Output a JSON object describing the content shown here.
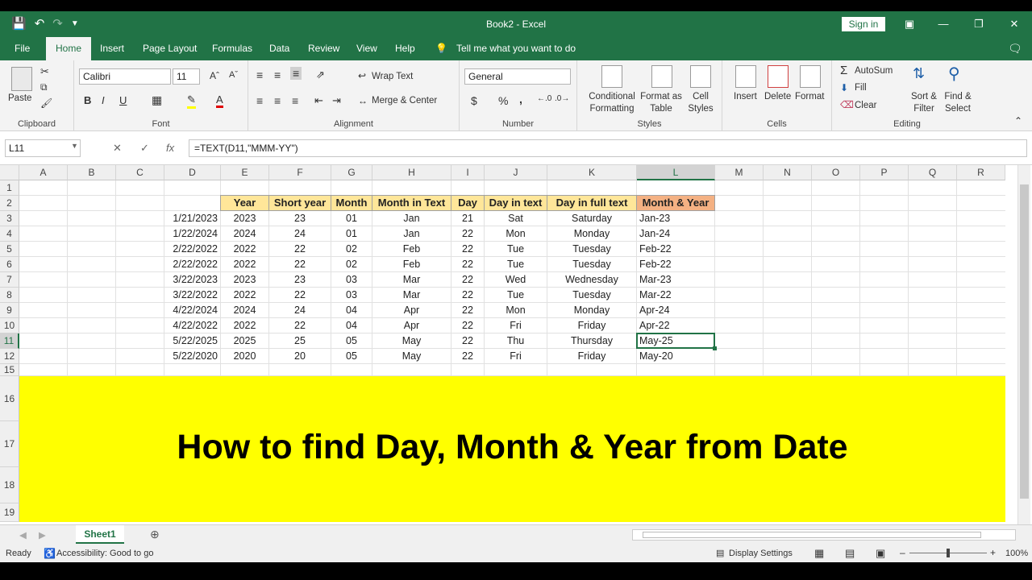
{
  "window": {
    "title": "Book2  -  Excel",
    "sign_in": "Sign in"
  },
  "tabs": [
    "File",
    "Home",
    "Insert",
    "Page Layout",
    "Formulas",
    "Data",
    "Review",
    "View",
    "Help"
  ],
  "tell_me": "Tell me what you want to do",
  "ribbon": {
    "clipboard": {
      "paste": "Paste",
      "label": "Clipboard"
    },
    "font": {
      "name": "Calibri",
      "size": "11",
      "bold": "B",
      "italic": "I",
      "underline": "U",
      "label": "Font"
    },
    "alignment": {
      "wrap": "Wrap Text",
      "merge": "Merge & Center",
      "label": "Alignment"
    },
    "number": {
      "format": "General",
      "currency": "$",
      "percent": "%",
      "comma": ",",
      "label": "Number"
    },
    "styles": {
      "conditional": "Conditional Formatting",
      "format_table": "Format as Table",
      "cell_styles": "Cell Styles",
      "label": "Styles"
    },
    "cells": {
      "insert": "Insert",
      "delete": "Delete",
      "format": "Format",
      "label": "Cells"
    },
    "editing": {
      "autosum": "AutoSum",
      "fill": "Fill",
      "clear": "Clear",
      "sort": "Sort & Filter",
      "find": "Find & Select",
      "label": "Editing"
    }
  },
  "formula_bar": {
    "name_box": "L11",
    "formula": "=TEXT(D11,\"MMM-YY\")",
    "fx": "fx"
  },
  "columns": [
    "A",
    "B",
    "C",
    "D",
    "E",
    "F",
    "G",
    "H",
    "I",
    "J",
    "K",
    "L",
    "M",
    "N",
    "O",
    "P",
    "Q",
    "R"
  ],
  "rows": [
    "1",
    "2",
    "3",
    "4",
    "5",
    "6",
    "7",
    "8",
    "9",
    "10",
    "11",
    "12",
    "15",
    "16",
    "17",
    "18",
    "19"
  ],
  "table": {
    "headers": [
      "Year",
      "Short year",
      "Month",
      "Month in Text",
      "Day",
      "Day in text",
      "Day in full text",
      "Month & Year"
    ],
    "rows": [
      [
        "1/21/2023",
        "2023",
        "23",
        "01",
        "Jan",
        "21",
        "Sat",
        "Saturday",
        "Jan-23"
      ],
      [
        "1/22/2024",
        "2024",
        "24",
        "01",
        "Jan",
        "22",
        "Mon",
        "Monday",
        "Jan-24"
      ],
      [
        "2/22/2022",
        "2022",
        "22",
        "02",
        "Feb",
        "22",
        "Tue",
        "Tuesday",
        "Feb-22"
      ],
      [
        "2/22/2022",
        "2022",
        "22",
        "02",
        "Feb",
        "22",
        "Tue",
        "Tuesday",
        "Feb-22"
      ],
      [
        "3/22/2023",
        "2023",
        "23",
        "03",
        "Mar",
        "22",
        "Wed",
        "Wednesday",
        "Mar-23"
      ],
      [
        "3/22/2022",
        "2022",
        "22",
        "03",
        "Mar",
        "22",
        "Tue",
        "Tuesday",
        "Mar-22"
      ],
      [
        "4/22/2024",
        "2024",
        "24",
        "04",
        "Apr",
        "22",
        "Mon",
        "Monday",
        "Apr-24"
      ],
      [
        "4/22/2022",
        "2022",
        "22",
        "04",
        "Apr",
        "22",
        "Fri",
        "Friday",
        "Apr-22"
      ],
      [
        "5/22/2025",
        "2025",
        "25",
        "05",
        "May",
        "22",
        "Thu",
        "Thursday",
        "May-25"
      ],
      [
        "5/22/2020",
        "2020",
        "20",
        "05",
        "May",
        "22",
        "Fri",
        "Friday",
        "May-20"
      ]
    ]
  },
  "banner": "How to find Day, Month & Year from Date",
  "colors": {
    "excel_green": "#217346",
    "header_yellow": "#ffe699",
    "header_orange": "#f4b183",
    "banner_yellow": "#ffff00"
  },
  "sheet_tab": "Sheet1",
  "status": {
    "ready": "Ready",
    "accessibility": "Accessibility: Good to go",
    "display_settings": "Display Settings",
    "zoom": "100%"
  }
}
